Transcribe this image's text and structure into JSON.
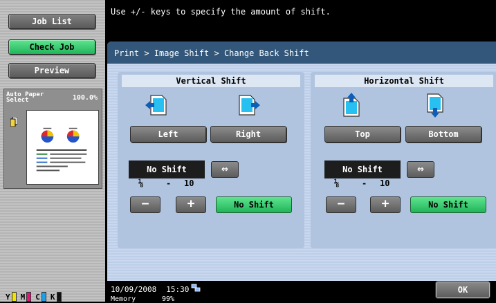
{
  "sidebar": {
    "job_list": "Job List",
    "check_job": "Check Job",
    "preview": "Preview",
    "paper_line1": "Auto Paper",
    "paper_line2": "Select",
    "zoom": "100.0%",
    "toner": [
      {
        "letter": "Y",
        "color": "#f2e600"
      },
      {
        "letter": "M",
        "color": "#e0157a"
      },
      {
        "letter": "C",
        "color": "#1ea0e6"
      },
      {
        "letter": "K",
        "color": "#111111"
      }
    ]
  },
  "message": "Use +/- keys to specify the amount of shift.",
  "dialog": {
    "breadcrumb": "Print > Image Shift > Change Back Shift",
    "vertical": {
      "title": "Vertical Shift",
      "btn_a": "Left",
      "btn_b": "Right",
      "value": "No Shift",
      "swap": "⇔",
      "range_min": "⅛",
      "range_sep": "-",
      "range_max": "10",
      "minus": "−",
      "plus": "+",
      "reset": "No Shift"
    },
    "horizontal": {
      "title": "Horizontal Shift",
      "btn_a": "Top",
      "btn_b": "Bottom",
      "value": "No Shift",
      "swap": "⇔",
      "range_min": "⅛",
      "range_sep": "-",
      "range_max": "10",
      "minus": "−",
      "plus": "+",
      "reset": "No Shift"
    }
  },
  "status": {
    "date": "10/09/2008",
    "time": "15:30",
    "memory_label": "Memory",
    "memory_value": "99%"
  },
  "ok": "OK",
  "colors": {
    "accent_green": "#2fc868",
    "title_bar": "#33577a",
    "dialog_bg": "#cfd9ea"
  }
}
